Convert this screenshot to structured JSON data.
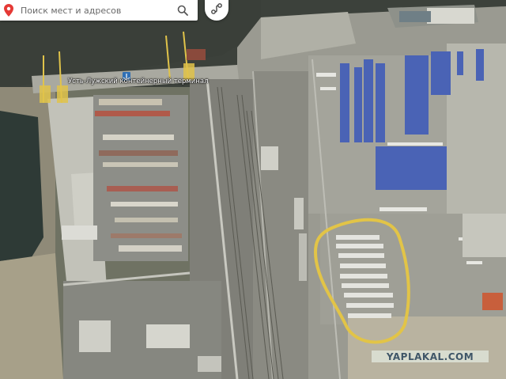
{
  "search": {
    "placeholder": "Поиск мест и адресов"
  },
  "map": {
    "place_label": "Усть-Лужский контейнерный терминал"
  },
  "watermark": {
    "text": "YAPLAKAL.COM"
  },
  "colors": {
    "water": "#3b403a",
    "highlight": "#e2c447",
    "pin": "#e53935",
    "container_blue": "#4a63b5"
  },
  "icons": [
    "map-pin-icon",
    "search-icon",
    "route-icon",
    "anchor-icon"
  ]
}
